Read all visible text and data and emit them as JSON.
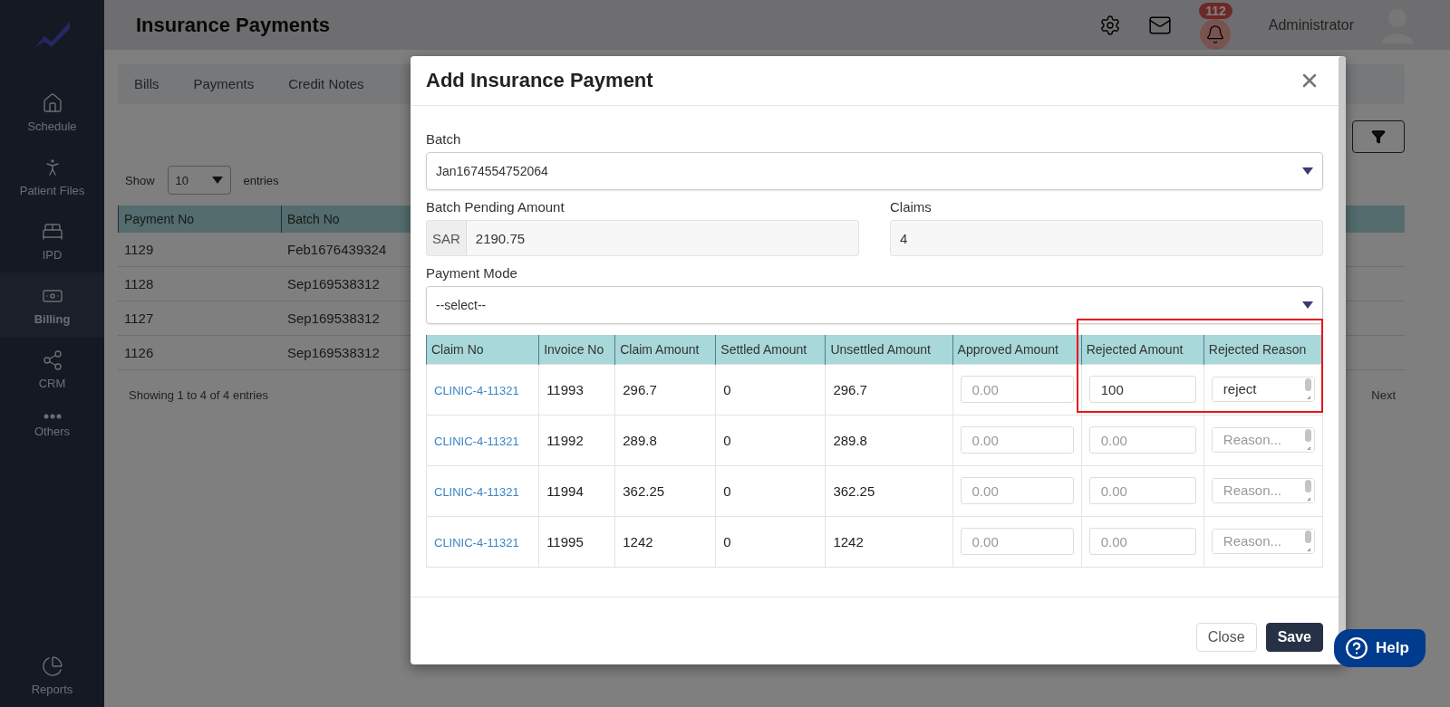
{
  "sidebar": {
    "items": [
      {
        "label": "Schedule",
        "selected": false
      },
      {
        "label": "Patient Files",
        "selected": false
      },
      {
        "label": "IPD",
        "selected": false
      },
      {
        "label": "Billing",
        "selected": true
      },
      {
        "label": "CRM",
        "selected": false
      },
      {
        "label": "Others",
        "selected": false
      }
    ],
    "bottom_item": {
      "label": "Reports",
      "selected": false
    }
  },
  "header": {
    "title": "Insurance Payments",
    "notification_count": "112",
    "user": "Administrator"
  },
  "tabs": [
    {
      "label": "Bills",
      "selected": false
    },
    {
      "label": "Payments",
      "selected": false
    },
    {
      "label": "Credit Notes",
      "selected": false
    }
  ],
  "list": {
    "show_label": "Show",
    "page_size": "10",
    "entries_label": "entries",
    "columns": [
      "Payment No",
      "Batch No"
    ],
    "rows": [
      [
        "1129",
        "Feb1676439324"
      ],
      [
        "1128",
        "Sep169538312"
      ],
      [
        "1127",
        "Sep169538312"
      ],
      [
        "1126",
        "Sep169538312"
      ]
    ],
    "info": "Showing 1 to 4 of 4 entries",
    "next": "Next"
  },
  "modal": {
    "title": "Add Insurance Payment",
    "batch": {
      "label": "Batch",
      "value": "Jan1674554752064"
    },
    "pending": {
      "label": "Batch Pending Amount",
      "prefix": "SAR",
      "value": "2190.75"
    },
    "claims": {
      "label": "Claims",
      "value": "4"
    },
    "payment_mode": {
      "label": "Payment Mode",
      "value": "--select--"
    },
    "columns": [
      "Claim No",
      "Invoice No",
      "Claim Amount",
      "Settled Amount",
      "Unsettled Amount",
      "Approved Amount",
      "Rejected Amount",
      "Rejected Reason"
    ],
    "rows": [
      {
        "claim_no": "CLINIC-4-11321",
        "invoice_no": "11993",
        "claim_amount": "296.7",
        "settled": "0",
        "unsettled": "296.7",
        "approved": {
          "placeholder": "0.00"
        },
        "rejected": {
          "value": "100"
        },
        "reason": {
          "value": "reject"
        },
        "highlighted": true
      },
      {
        "claim_no": "CLINIC-4-11321",
        "invoice_no": "11992",
        "claim_amount": "289.8",
        "settled": "0",
        "unsettled": "289.8",
        "approved": {
          "placeholder": "0.00"
        },
        "rejected": {
          "placeholder": "0.00"
        },
        "reason": {
          "placeholder": "Reason..."
        },
        "highlighted": false
      },
      {
        "claim_no": "CLINIC-4-11321",
        "invoice_no": "11994",
        "claim_amount": "362.25",
        "settled": "0",
        "unsettled": "362.25",
        "approved": {
          "placeholder": "0.00"
        },
        "rejected": {
          "placeholder": "0.00"
        },
        "reason": {
          "placeholder": "Reason..."
        },
        "highlighted": false
      },
      {
        "claim_no": "CLINIC-4-11321",
        "invoice_no": "11995",
        "claim_amount": "1242",
        "settled": "0",
        "unsettled": "1242",
        "approved": {
          "placeholder": "0.00"
        },
        "rejected": {
          "placeholder": "0.00"
        },
        "reason": {
          "placeholder": "Reason..."
        },
        "highlighted": false
      }
    ],
    "buttons": [
      {
        "label": "Close",
        "kind": "secondary"
      },
      {
        "label": "Save",
        "kind": "primary"
      }
    ]
  },
  "help": {
    "label": "Help"
  }
}
